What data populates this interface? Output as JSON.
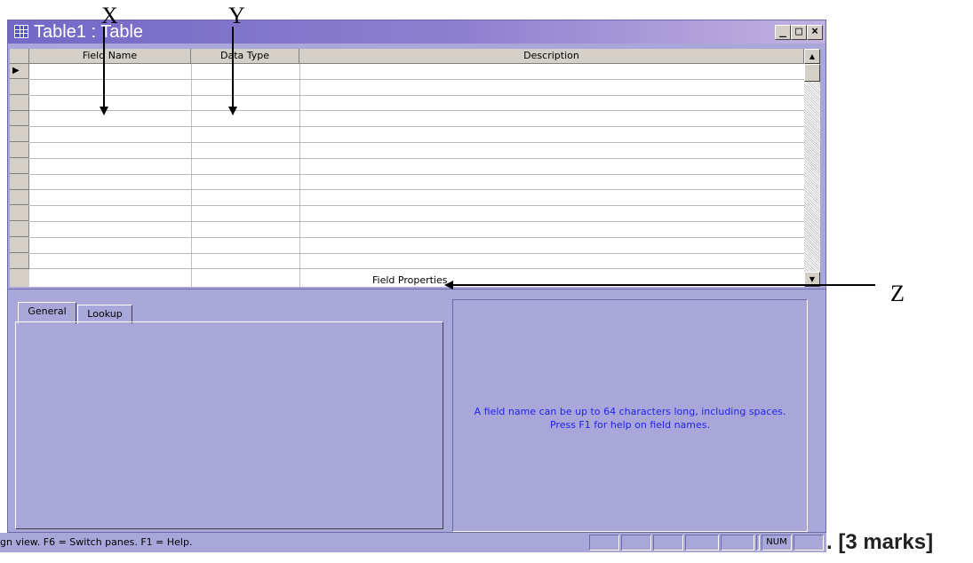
{
  "window": {
    "title": "Table1 : Table",
    "controls": {
      "minimize": "_",
      "maximize": "□",
      "close": "×"
    }
  },
  "grid": {
    "columns": [
      "Field Name",
      "Data Type",
      "Description"
    ],
    "rows": [
      "",
      "",
      "",
      "",
      "",
      "",
      "",
      "",
      "",
      "",
      "",
      "",
      ""
    ],
    "current_row_indicator": "▶"
  },
  "field_properties": {
    "label": "Field Properties",
    "tabs": [
      "General",
      "Lookup"
    ],
    "active_tab": "General",
    "help_text_line1": "A field name can be up to 64 characters long, including spaces.",
    "help_text_line2": "Press F1 for help on field names."
  },
  "statusbar": {
    "text": "gn view.  F6 = Switch panes.  F1 = Help.",
    "indicators": [
      "",
      "",
      "",
      "",
      "",
      "",
      "NUM",
      ""
    ]
  },
  "annotations": {
    "x_label": "X",
    "y_label": "Y",
    "z_label": "Z",
    "marks_text": ". [3 marks]"
  },
  "colors": {
    "window_bg": "#a9a7d9",
    "titlebar": "#7468c8",
    "help_text": "#2222ee"
  }
}
